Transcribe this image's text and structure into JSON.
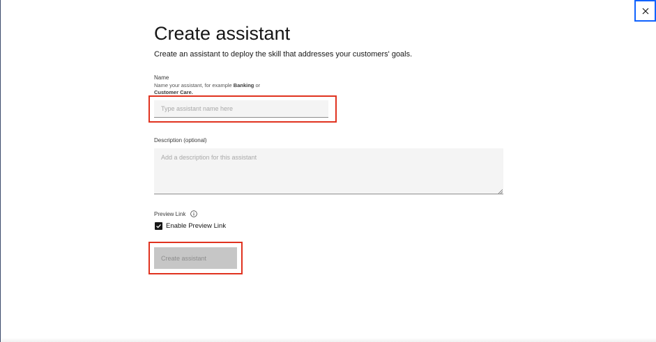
{
  "modal": {
    "title": "Create assistant",
    "subtitle": "Create an assistant to deploy the skill that addresses your customers' goals.",
    "close_icon": "close-icon"
  },
  "name_field": {
    "label": "Name",
    "helper_prefix": "Name your assistant, for example ",
    "helper_bold_1": "Banking",
    "helper_middle": " or",
    "helper_bold_2": "Customer Care",
    "helper_suffix": ".",
    "value": "",
    "placeholder": "Type assistant name here"
  },
  "description_field": {
    "label": "Description (optional)",
    "value": "",
    "placeholder": "Add a description for this assistant"
  },
  "preview_link": {
    "label": "Preview Link",
    "info_icon": "info-icon",
    "checkbox_label": "Enable Preview Link",
    "checked": true
  },
  "actions": {
    "create_label": "Create assistant",
    "disabled": true
  },
  "colors": {
    "accent": "#0f62fe",
    "highlight": "#e0321f",
    "field_bg": "#f4f4f4",
    "disabled_button_bg": "#c6c6c6"
  }
}
